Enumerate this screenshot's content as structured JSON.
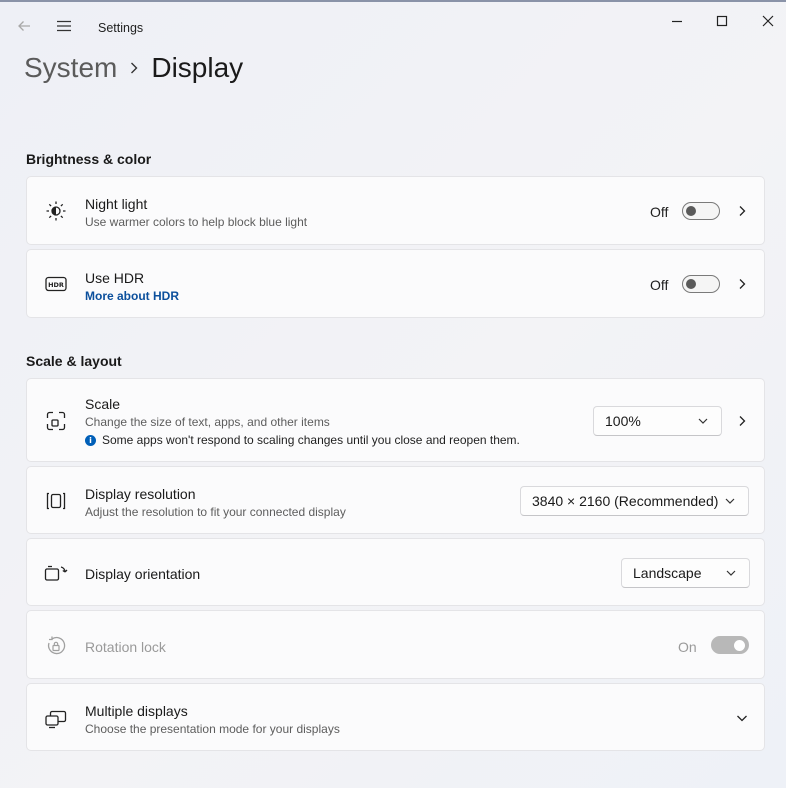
{
  "window": {
    "app_title": "Settings",
    "controls": {
      "minimize": "minimize-icon",
      "maximize": "maximize-icon",
      "close": "close-icon"
    }
  },
  "breadcrumb": {
    "parent": "System",
    "current": "Display"
  },
  "sections": {
    "brightness": {
      "title": "Brightness & color",
      "night_light": {
        "title": "Night light",
        "subtitle": "Use warmer colors to help block blue light",
        "state": "Off",
        "icon": "brightness-icon"
      },
      "hdr": {
        "title": "Use HDR",
        "link": "More about HDR",
        "state": "Off",
        "icon": "hdr-icon"
      }
    },
    "scale_layout": {
      "title": "Scale & layout",
      "scale": {
        "title": "Scale",
        "subtitle": "Change the size of text, apps, and other items",
        "note": "Some apps won't respond to scaling changes until you close and reopen them.",
        "value": "100%",
        "icon": "scale-icon"
      },
      "resolution": {
        "title": "Display resolution",
        "subtitle": "Adjust the resolution to fit your connected display",
        "value": "3840 × 2160 (Recommended)",
        "icon": "resolution-icon"
      },
      "orientation": {
        "title": "Display orientation",
        "value": "Landscape",
        "icon": "orientation-icon"
      },
      "rotation_lock": {
        "title": "Rotation lock",
        "state": "On",
        "enabled": false,
        "icon": "rotation-lock-icon"
      },
      "multiple_displays": {
        "title": "Multiple displays",
        "subtitle": "Choose the presentation mode for your displays",
        "icon": "multiple-displays-icon"
      }
    }
  }
}
